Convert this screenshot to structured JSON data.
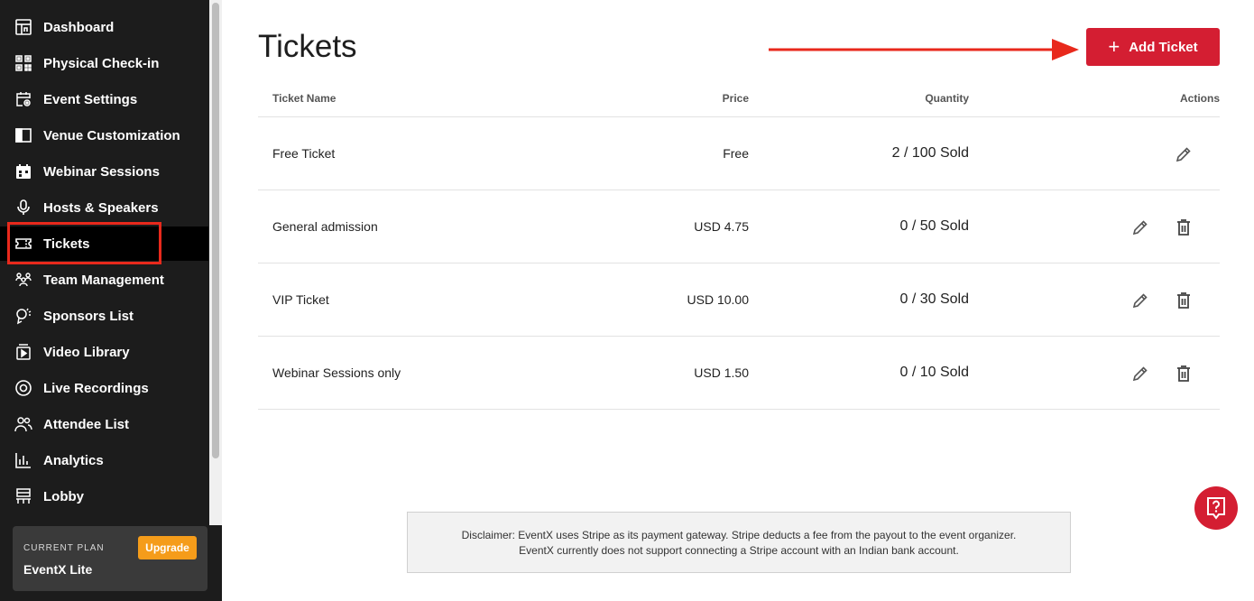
{
  "sidebar": {
    "items": [
      {
        "label": "Dashboard",
        "icon": "dashboard-icon"
      },
      {
        "label": "Physical Check-in",
        "icon": "qr-code-icon"
      },
      {
        "label": "Event Settings",
        "icon": "calendar-gear-icon"
      },
      {
        "label": "Venue Customization",
        "icon": "layout-icon"
      },
      {
        "label": "Webinar Sessions",
        "icon": "calendar-grid-icon"
      },
      {
        "label": "Hosts & Speakers",
        "icon": "microphone-icon"
      },
      {
        "label": "Tickets",
        "icon": "ticket-icon",
        "active": true
      },
      {
        "label": "Team Management",
        "icon": "team-icon"
      },
      {
        "label": "Sponsors List",
        "icon": "sponsor-icon"
      },
      {
        "label": "Video Library",
        "icon": "video-icon"
      },
      {
        "label": "Live Recordings",
        "icon": "record-icon"
      },
      {
        "label": "Attendee List",
        "icon": "attendees-icon"
      },
      {
        "label": "Analytics",
        "icon": "bar-chart-icon"
      },
      {
        "label": "Lobby",
        "icon": "lobby-icon"
      }
    ],
    "plan": {
      "label": "CURRENT PLAN",
      "name": "EventX Lite",
      "upgrade_label": "Upgrade"
    }
  },
  "main": {
    "title": "Tickets",
    "add_button_label": "Add Ticket",
    "table": {
      "headers": {
        "name": "Ticket Name",
        "price": "Price",
        "quantity": "Quantity",
        "actions": "Actions"
      },
      "rows": [
        {
          "name": "Free Ticket",
          "price": "Free",
          "quantity": "2 / 100 Sold",
          "deletable": false
        },
        {
          "name": "General admission",
          "price": "USD 4.75",
          "quantity": "0 / 50 Sold",
          "deletable": true
        },
        {
          "name": "VIP Ticket",
          "price": "USD 10.00",
          "quantity": "0 / 30 Sold",
          "deletable": true
        },
        {
          "name": "Webinar Sessions only",
          "price": "USD 1.50",
          "quantity": "0 / 10 Sold",
          "deletable": true
        }
      ]
    },
    "disclaimer": {
      "line1": "Disclaimer: EventX uses Stripe as its payment gateway. Stripe deducts a fee from the payout to the event organizer.",
      "line2": "EventX currently does not support connecting a Stripe account with an Indian bank account."
    }
  },
  "colors": {
    "sidebar_bg": "#1c1c1c",
    "accent": "#d41e32",
    "highlight": "#e8291c",
    "upgrade": "#f59c1a"
  }
}
